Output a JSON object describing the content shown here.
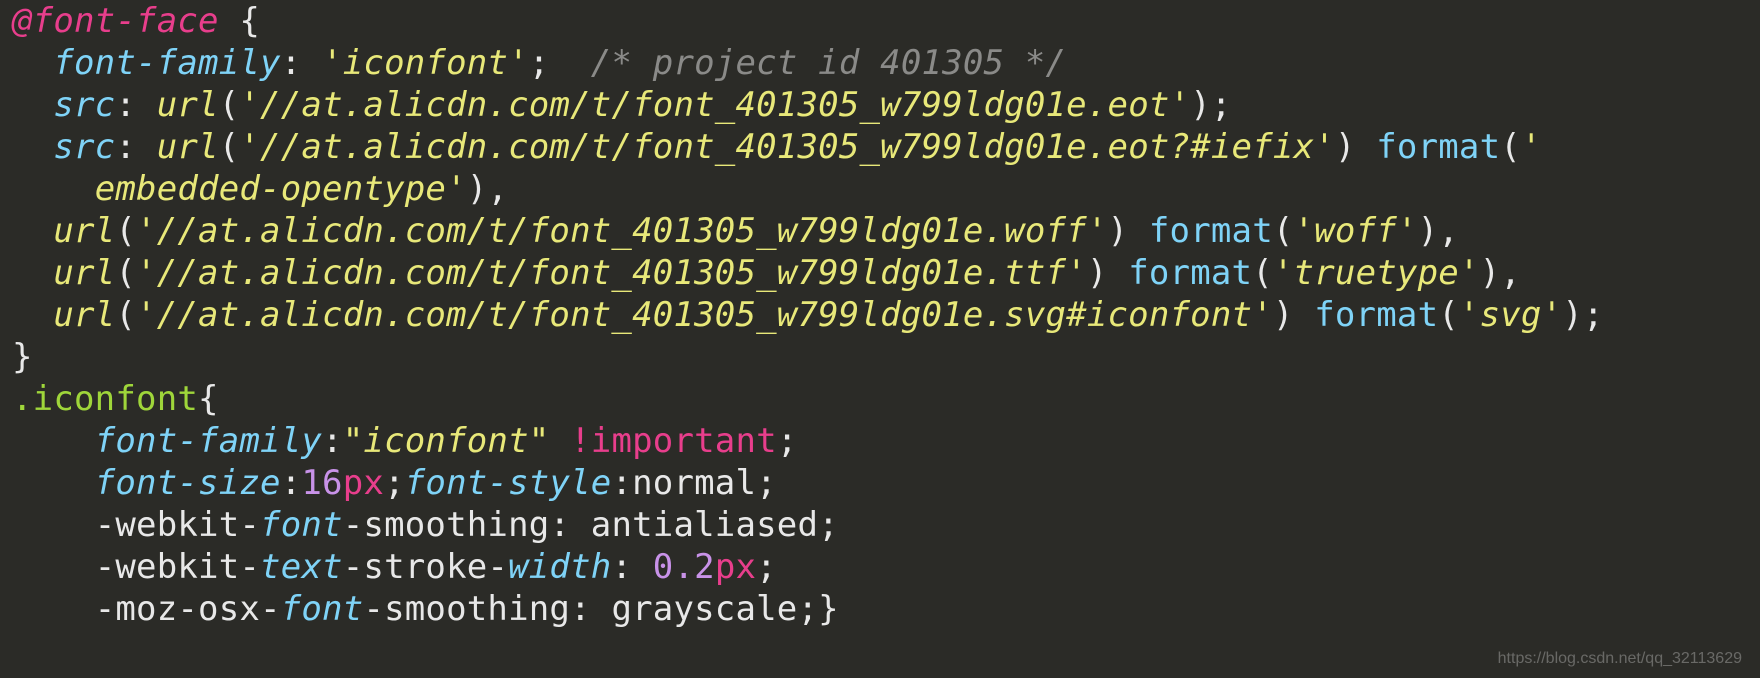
{
  "code": {
    "atrule": "@font-face",
    "selector": ".iconfont",
    "font_family_value": "'iconfont'",
    "font_family_value2": "\"iconfont\"",
    "comment": "/* project id 401305 */",
    "url1": "'//at.alicdn.com/t/font_401305_w799ldg01e.eot'",
    "url2": "'//at.alicdn.com/t/font_401305_w799ldg01e.eot?#iefix'",
    "fmt2_cont": "embedded-opentype'",
    "url3": "'//at.alicdn.com/t/font_401305_w799ldg01e.woff'",
    "fmt3": "'woff'",
    "url4": "'//at.alicdn.com/t/font_401305_w799ldg01e.ttf'",
    "fmt4": "'truetype'",
    "url5": "'//at.alicdn.com/t/font_401305_w799ldg01e.svg#iconfont'",
    "fmt5": "'svg'",
    "important": "!important",
    "fs_num": "16",
    "fs_unit": "px",
    "stroke_num": "0.2",
    "stroke_unit": "px",
    "normal": "normal",
    "antialiased": "antialiased",
    "grayscale": "grayscale"
  },
  "tokens": {
    "font_family": "font-family",
    "src": "src",
    "url": "url",
    "format": "format",
    "font_size": "font-size",
    "font_style": "font-style",
    "webkit": "-webkit-",
    "font": "font",
    "smoothing": "-smoothing",
    "text": "text",
    "stroke": "-stroke-",
    "width": "width",
    "moz": "-moz-osx-"
  },
  "watermark": "https://blog.csdn.net/qq_32113629"
}
